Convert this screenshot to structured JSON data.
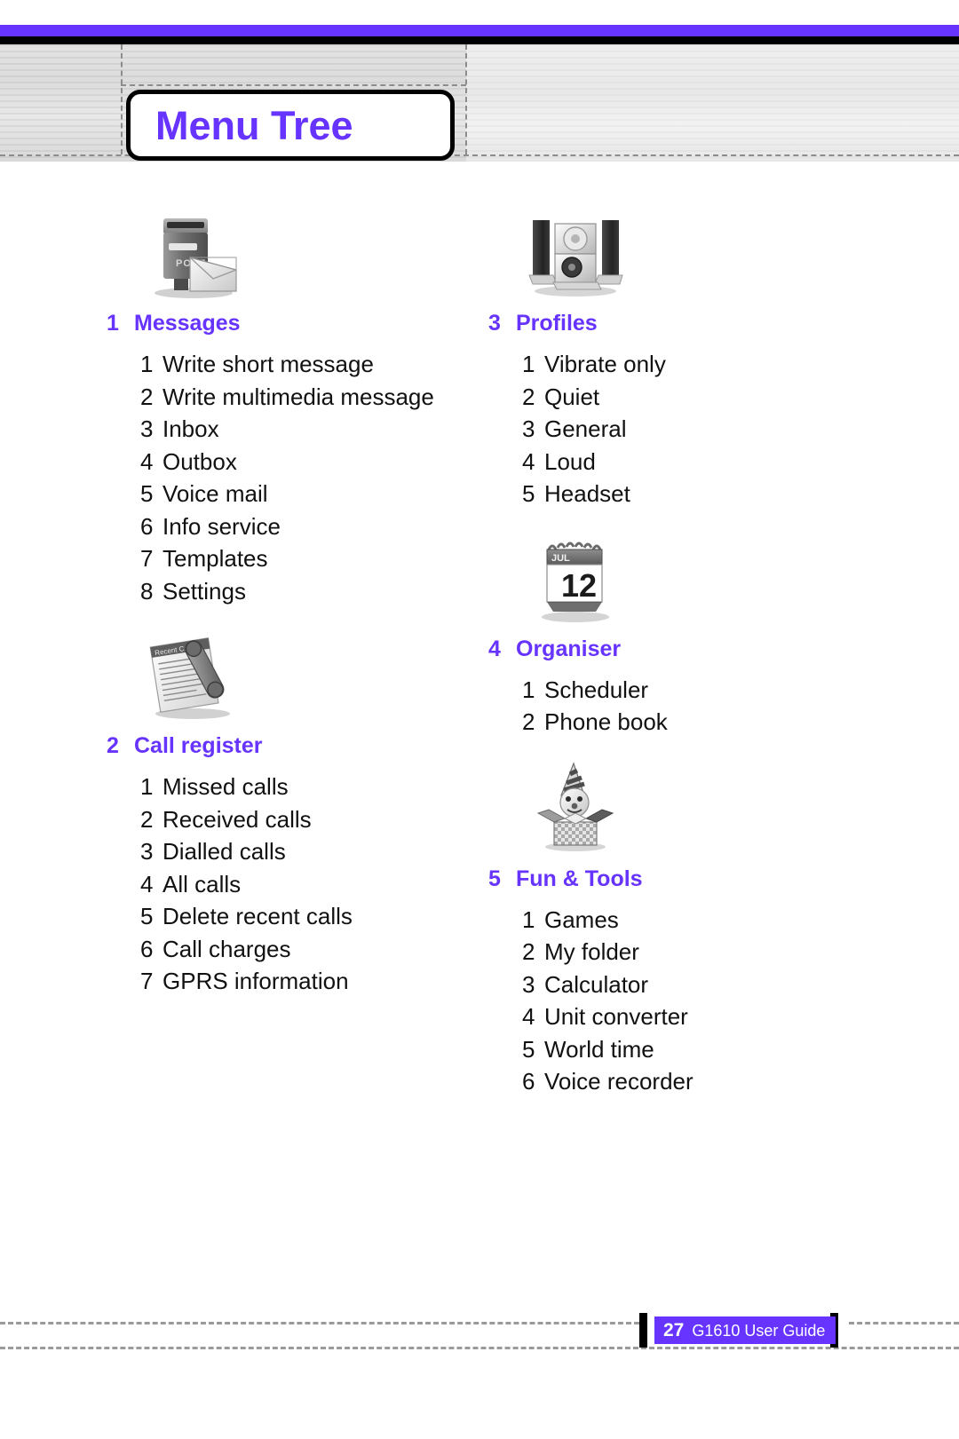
{
  "page": {
    "title": "Menu Tree",
    "accent_color": "#6633ff",
    "footer": {
      "page_number": "27",
      "guide_title": "G1610 User Guide"
    }
  },
  "columns": {
    "left": [
      {
        "number": "1",
        "label": "Messages",
        "icon": "mailbox-icon",
        "items": [
          {
            "n": "1",
            "t": "Write short message"
          },
          {
            "n": "2",
            "t": "Write multimedia message"
          },
          {
            "n": "3",
            "t": "Inbox"
          },
          {
            "n": "4",
            "t": "Outbox"
          },
          {
            "n": "5",
            "t": "Voice mail"
          },
          {
            "n": "6",
            "t": "Info service"
          },
          {
            "n": "7",
            "t": "Templates"
          },
          {
            "n": "8",
            "t": "Settings"
          }
        ]
      },
      {
        "number": "2",
        "label": "Call register",
        "icon": "call-log-icon",
        "items": [
          {
            "n": "1",
            "t": "Missed calls"
          },
          {
            "n": "2",
            "t": "Received calls"
          },
          {
            "n": "3",
            "t": "Dialled calls"
          },
          {
            "n": "4",
            "t": "All calls"
          },
          {
            "n": "5",
            "t": "Delete recent calls"
          },
          {
            "n": "6",
            "t": "Call charges"
          },
          {
            "n": "7",
            "t": "GPRS information"
          }
        ]
      }
    ],
    "right": [
      {
        "number": "3",
        "label": "Profiles",
        "icon": "speakers-icon",
        "items": [
          {
            "n": "1",
            "t": "Vibrate only"
          },
          {
            "n": "2",
            "t": "Quiet"
          },
          {
            "n": "3",
            "t": "General"
          },
          {
            "n": "4",
            "t": "Loud"
          },
          {
            "n": "5",
            "t": "Headset"
          }
        ]
      },
      {
        "number": "4",
        "label": "Organiser",
        "icon": "calendar-icon",
        "icon_month": "JUL",
        "icon_day": "12",
        "items": [
          {
            "n": "1",
            "t": "Scheduler"
          },
          {
            "n": "2",
            "t": "Phone book"
          }
        ]
      },
      {
        "number": "5",
        "label": "Fun & Tools",
        "icon": "jack-in-the-box-icon",
        "items": [
          {
            "n": "1",
            "t": "Games"
          },
          {
            "n": "2",
            "t": "My folder"
          },
          {
            "n": "3",
            "t": "Calculator"
          },
          {
            "n": "4",
            "t": "Unit converter"
          },
          {
            "n": "5",
            "t": "World time"
          },
          {
            "n": "6",
            "t": "Voice recorder"
          }
        ]
      }
    ]
  }
}
